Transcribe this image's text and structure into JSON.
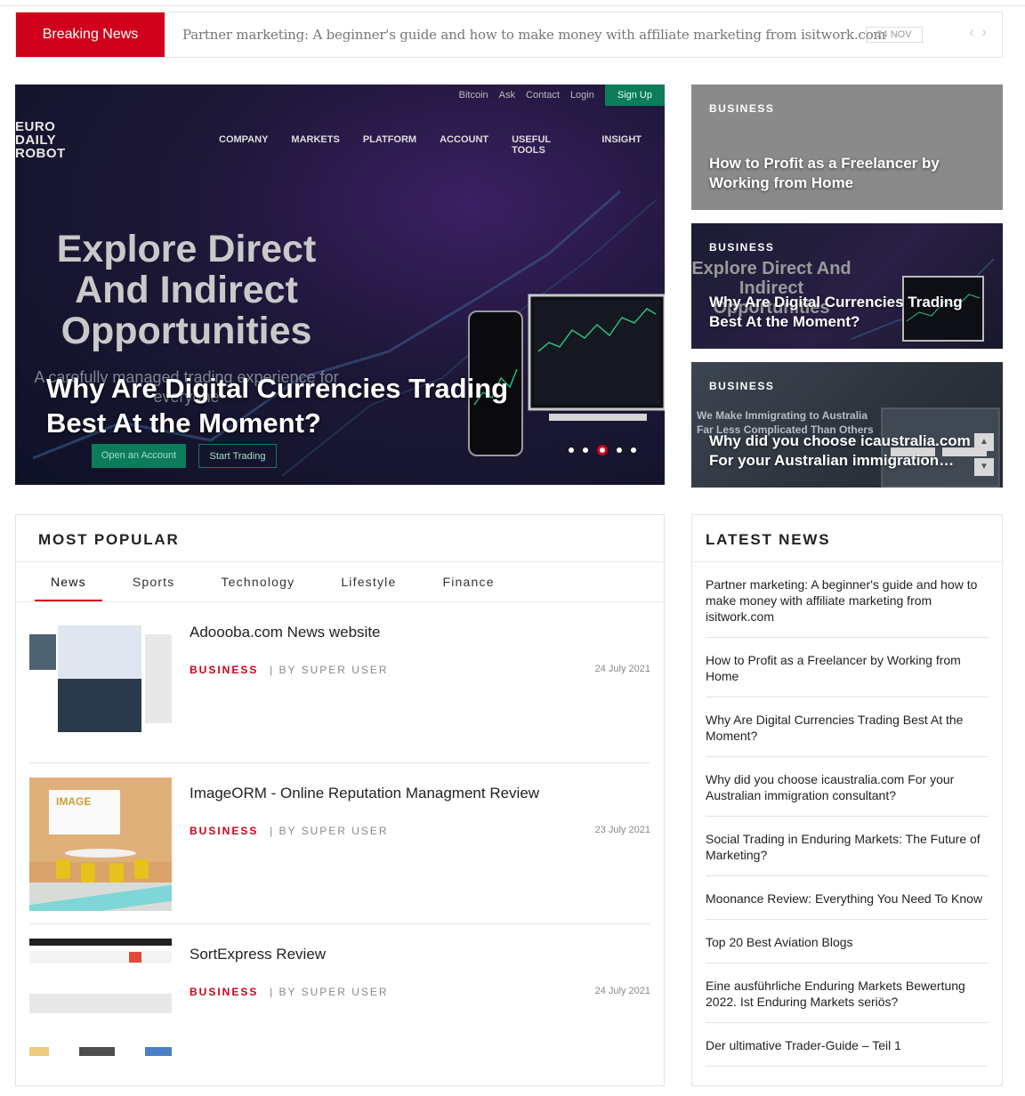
{
  "breaking": {
    "label": "Breaking News",
    "headline": "Partner marketing: A beginner's guide and how to make money with affiliate marketing from isitwork.com",
    "date": "24 NOV",
    "nav_icon": "chevron-left-right-icon"
  },
  "hero": {
    "topnav": [
      "Bitcoin",
      "Ask",
      "Contact",
      "Login",
      "Sign Up"
    ],
    "logo_lines": [
      "EURO",
      "DAILY",
      "ROBOT"
    ],
    "menu": [
      "COMPANY",
      "MARKETS",
      "PLATFORM",
      "ACCOUNT",
      "USEFUL TOOLS",
      "INSIGHT"
    ],
    "headline": "Explore Direct And Indirect Opportunities",
    "subline": "A carefully managed trading experience for everyone",
    "button_open": "Open an Account",
    "button_start": "Start Trading",
    "title": "Why Are Digital Currencies Trading Best At the Moment?",
    "slide_index": 3,
    "slide_count": 5
  },
  "side_cards": [
    {
      "category": "BUSINESS",
      "title": "How to Profit as a Freelancer by Working from Home"
    },
    {
      "category": "BUSINESS",
      "title": "Why Are Digital Currencies Trading Best At the Moment?",
      "ghost": "Explore Direct And Indirect Opportunities"
    },
    {
      "category": "BUSINESS",
      "title": "Why did you choose icaustralia.com For your Australian immigration…",
      "ghost": "We Make Immigrating to Australia Far Less Complicated Than Others"
    }
  ],
  "popular": {
    "title": "MOST POPULAR",
    "tabs": [
      "News",
      "Sports",
      "Technology",
      "Lifestyle",
      "Finance"
    ],
    "active_tab": "News",
    "articles": [
      {
        "title": "Adoooba.com News website",
        "category": "BUSINESS",
        "author": "|  BY SUPER USER",
        "date": "24 July 2021"
      },
      {
        "title": "ImageORM - Online Reputation Managment Review",
        "category": "BUSINESS",
        "author": "|  BY SUPER USER",
        "date": "23 July 2021"
      },
      {
        "title": "SortExpress Review",
        "category": "BUSINESS",
        "author": "|  BY SUPER USER",
        "date": "24 July 2021"
      }
    ]
  },
  "latest": {
    "title": "LATEST NEWS",
    "items": [
      "Partner marketing: A beginner's guide and how to make money with affiliate marketing from isitwork.com",
      "How to Profit as a Freelancer by Working from Home",
      "Why Are Digital Currencies Trading Best At the Moment?",
      "Why did you choose icaustralia.com For your Australian immigration consultant?",
      "Social Trading in Enduring Markets: The Future of Marketing?",
      "Moonance Review: Everything You Need To Know",
      "Top 20 Best Aviation Blogs",
      "Eine ausführliche Enduring Markets Bewertung 2022. Ist Enduring Markets seriös?",
      "Der ultimative Trader-Guide – Teil 1"
    ]
  },
  "colors": {
    "accent": "#d0021b",
    "button_green": "#0c7c5b"
  }
}
